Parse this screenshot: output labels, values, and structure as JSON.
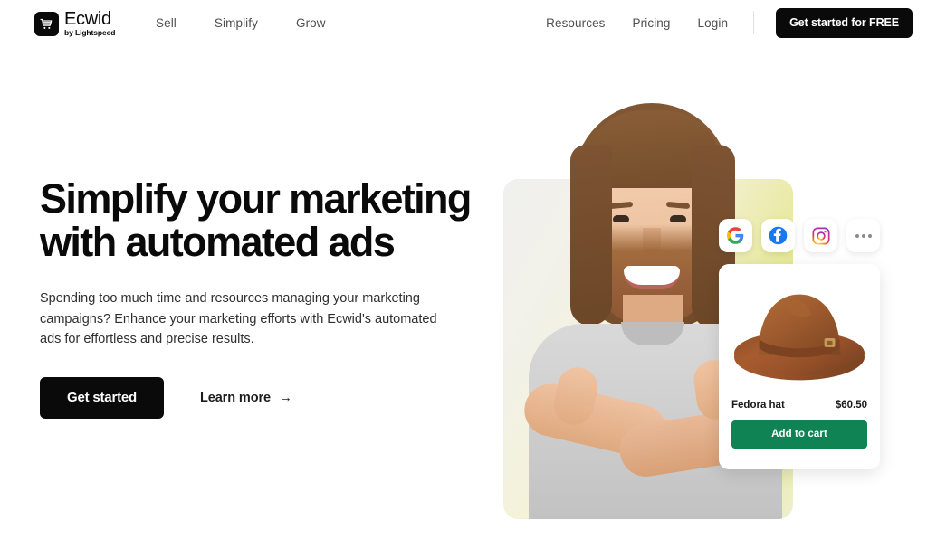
{
  "header": {
    "brand": {
      "icon": "shopping-cart-icon",
      "name": "Ecwid",
      "tagline": "by Lightspeed"
    },
    "nav_left": [
      {
        "label": "Sell"
      },
      {
        "label": "Simplify"
      },
      {
        "label": "Grow"
      }
    ],
    "nav_right": [
      {
        "label": "Resources"
      },
      {
        "label": "Pricing"
      },
      {
        "label": "Login"
      }
    ],
    "cta_label": "Get started for FREE"
  },
  "hero": {
    "title": "Simplify your marketing with automated ads",
    "subtitle": "Spending too much time and resources managing your marketing campaigns? Enhance your marketing efforts with Ecwid's automated ads for effortless and precise results.",
    "primary_cta": "Get started",
    "secondary_cta": "Learn more",
    "secondary_cta_arrow": "→"
  },
  "social_tiles": [
    {
      "name": "google-icon",
      "label": "Google"
    },
    {
      "name": "facebook-icon",
      "label": "Facebook"
    },
    {
      "name": "instagram-icon",
      "label": "Instagram"
    },
    {
      "name": "more-options-icon",
      "label": "More"
    }
  ],
  "product_card": {
    "image_alt": "brown-fedora-hat",
    "name": "Fedora hat",
    "price": "$60.50",
    "cart_button": "Add to cart"
  },
  "colors": {
    "brand_black": "#0a0a0a",
    "cart_green": "#0f8354",
    "nav_text": "#4f4f4f",
    "body_text": "#2f2f2f",
    "hero_gradient_start": "#f0f0ee",
    "hero_gradient_end": "#e3e88c"
  }
}
